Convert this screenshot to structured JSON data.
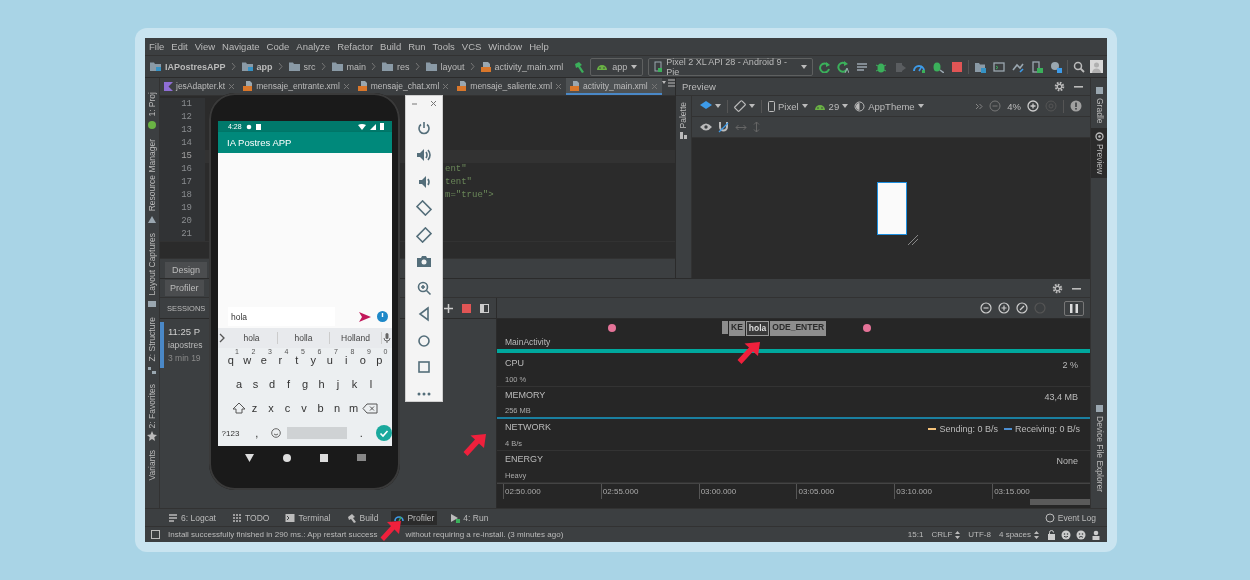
{
  "menu": [
    "File",
    "Edit",
    "View",
    "Navigate",
    "Code",
    "Analyze",
    "Refactor",
    "Build",
    "Run",
    "Tools",
    "VCS",
    "Window",
    "Help"
  ],
  "breadcrumbs": [
    "IAPostresAPP",
    "app",
    "src",
    "main",
    "res",
    "layout",
    "activity_main.xml"
  ],
  "toolbar": {
    "run_config": "app",
    "device": "Pixel 2 XL API 28 - Android 9 - Pie"
  },
  "editor": {
    "tabs": [
      {
        "label": "jesAdapter.kt",
        "selected": false
      },
      {
        "label": "mensaje_entrante.xml",
        "selected": false
      },
      {
        "label": "mensaje_chat.xml",
        "selected": false
      },
      {
        "label": "mensaje_saliente.xml",
        "selected": false
      },
      {
        "label": "activity_main.xml",
        "selected": true
      }
    ],
    "lines": [
      {
        "number": "11",
        "selected": false
      },
      {
        "number": "12",
        "selected": false
      },
      {
        "number": "13",
        "selected": false
      },
      {
        "number": "14",
        "selected": false
      },
      {
        "number": "15",
        "selected": true
      },
      {
        "number": "16",
        "selected": false,
        "text": "ent\""
      },
      {
        "number": "17",
        "selected": false,
        "text": "tent\""
      },
      {
        "number": "18",
        "selected": false,
        "text": "m=\"true\">"
      },
      {
        "number": "19",
        "selected": false
      },
      {
        "number": "20",
        "selected": false
      },
      {
        "number": "21",
        "selected": false
      }
    ],
    "bottom_tab": "Design"
  },
  "preview": {
    "title": "Preview",
    "palette": "Palette",
    "device": "Pixel",
    "api": "29",
    "theme": "AppTheme",
    "zoom": "4%"
  },
  "profiler": {
    "title": "Profiler",
    "sessions_label": "SESSIONS",
    "session": {
      "time": "11:25 P",
      "name": "iapostres",
      "duration": "3 min 19",
      "selected": true
    },
    "events": [
      {
        "label": "KE",
        "selected": false
      },
      {
        "label": "hola",
        "selected": true
      },
      {
        "label": "ODE_ENTER",
        "selected": false
      }
    ],
    "activity": "MainActivity",
    "tracks": [
      {
        "name": "CPU",
        "scale": "100 %",
        "value": "2 %"
      },
      {
        "name": "MEMORY",
        "scale": "256 MB",
        "value": "43,4 MB"
      },
      {
        "name": "NETWORK",
        "scale": "4 B/s",
        "legend": [
          {
            "label": "Sending: 0 B/s",
            "color": "#f5c27a"
          },
          {
            "label": "Receiving: 0 B/s",
            "color": "#4c8ed1"
          }
        ]
      },
      {
        "name": "ENERGY",
        "scale": "Heavy",
        "value": "None"
      }
    ],
    "time_ticks": [
      "02:50.000",
      "02:55.000",
      "03:00.000",
      "03:05.000",
      "03:10.000",
      "03:15.000"
    ]
  },
  "side_left": [
    "1: Proj",
    "Resource Manager",
    "Layout Captures",
    "Z: Structure",
    "2: Favorites",
    "Variants"
  ],
  "side_right": [
    {
      "label": "Gradle",
      "selected": false
    },
    {
      "label": "Preview",
      "selected": true
    },
    {
      "label": "Device File Explorer",
      "selected": false
    }
  ],
  "bottom_tools": [
    {
      "label": "6: Logcat",
      "selected": false
    },
    {
      "label": "TODO",
      "selected": false
    },
    {
      "label": "Terminal",
      "selected": false
    },
    {
      "label": "Build",
      "selected": false
    },
    {
      "label": "Profiler",
      "selected": true
    },
    {
      "label": "4: Run",
      "selected": false
    }
  ],
  "event_log": "Event Log",
  "status": {
    "message_start": "Install successfully finished in 290 ms.: App restart success",
    "message_end": "without requiring a re-install. (3 minutes ago)",
    "position": "15:1",
    "line_separator": "CRLF",
    "encoding": "UTF-8",
    "indent": "4 spaces"
  },
  "phone": {
    "time": "4:28",
    "app_title": "IA Postres APP",
    "message": {
      "value": "hola"
    },
    "suggestions": [
      "hola",
      "holla",
      "Holland"
    ],
    "keys": [
      [
        {
          "key": "q",
          "hint": "1"
        },
        {
          "key": "w",
          "hint": "2"
        },
        {
          "key": "e",
          "hint": "3"
        },
        {
          "key": "r",
          "hint": "4"
        },
        {
          "key": "t",
          "hint": "5"
        },
        {
          "key": "y",
          "hint": "6"
        },
        {
          "key": "u",
          "hint": "7"
        },
        {
          "key": "i",
          "hint": "8"
        },
        {
          "key": "o",
          "hint": "9"
        },
        {
          "key": "p",
          "hint": "0"
        }
      ],
      [
        {
          "key": "a"
        },
        {
          "key": "s"
        },
        {
          "key": "d"
        },
        {
          "key": "f"
        },
        {
          "key": "g"
        },
        {
          "key": "h"
        },
        {
          "key": "j"
        },
        {
          "key": "k"
        },
        {
          "key": "l"
        }
      ],
      [
        {
          "key": "z"
        },
        {
          "key": "x"
        },
        {
          "key": "c"
        },
        {
          "key": "v"
        },
        {
          "key": "b"
        },
        {
          "key": "n"
        },
        {
          "key": "m"
        }
      ]
    ],
    "symbols_key": "?123",
    "comma_key": ",",
    "period_key": "."
  }
}
